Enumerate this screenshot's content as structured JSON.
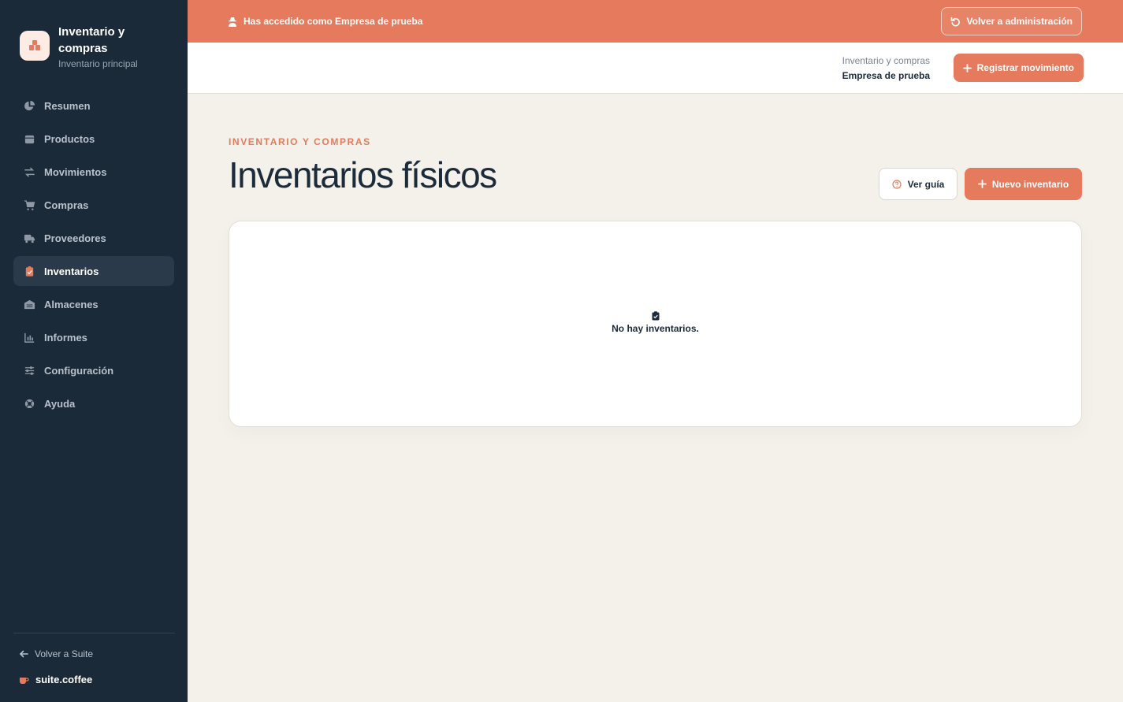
{
  "sidebar": {
    "brand": {
      "title": "Inventario y compras",
      "subtitle": "Inventario principal",
      "icon": "boxes-icon"
    },
    "items": [
      {
        "label": "Resumen",
        "icon": "pie-chart-icon",
        "active": false
      },
      {
        "label": "Productos",
        "icon": "box-icon",
        "active": false
      },
      {
        "label": "Movimientos",
        "icon": "arrows-exchange-icon",
        "active": false
      },
      {
        "label": "Compras",
        "icon": "cart-icon",
        "active": false
      },
      {
        "label": "Proveedores",
        "icon": "truck-icon",
        "active": false
      },
      {
        "label": "Inventarios",
        "icon": "clipboard-check-icon",
        "active": true
      },
      {
        "label": "Almacenes",
        "icon": "warehouse-icon",
        "active": false
      },
      {
        "label": "Informes",
        "icon": "bar-chart-icon",
        "active": false
      },
      {
        "label": "Configuración",
        "icon": "sliders-icon",
        "active": false
      },
      {
        "label": "Ayuda",
        "icon": "lifebuoy-icon",
        "active": false
      }
    ],
    "back_label": "Volver a Suite",
    "suite_label": "suite.coffee"
  },
  "impersonation": {
    "text": "Has accedido como Empresa de prueba",
    "button_label": "Volver a administración"
  },
  "header": {
    "context_app": "Inventario y compras",
    "context_company": "Empresa de prueba",
    "register_label": "Registrar movimiento"
  },
  "main": {
    "eyebrow": "INVENTARIO Y COMPRAS",
    "title": "Inventarios físicos",
    "guide_label": "Ver guía",
    "new_label": "Nuevo inventario",
    "empty_text": "No hay inventarios."
  },
  "colors": {
    "accent": "#e57a5c",
    "sidebar_bg": "#1b2a38",
    "page_bg": "#f4f1eb"
  }
}
